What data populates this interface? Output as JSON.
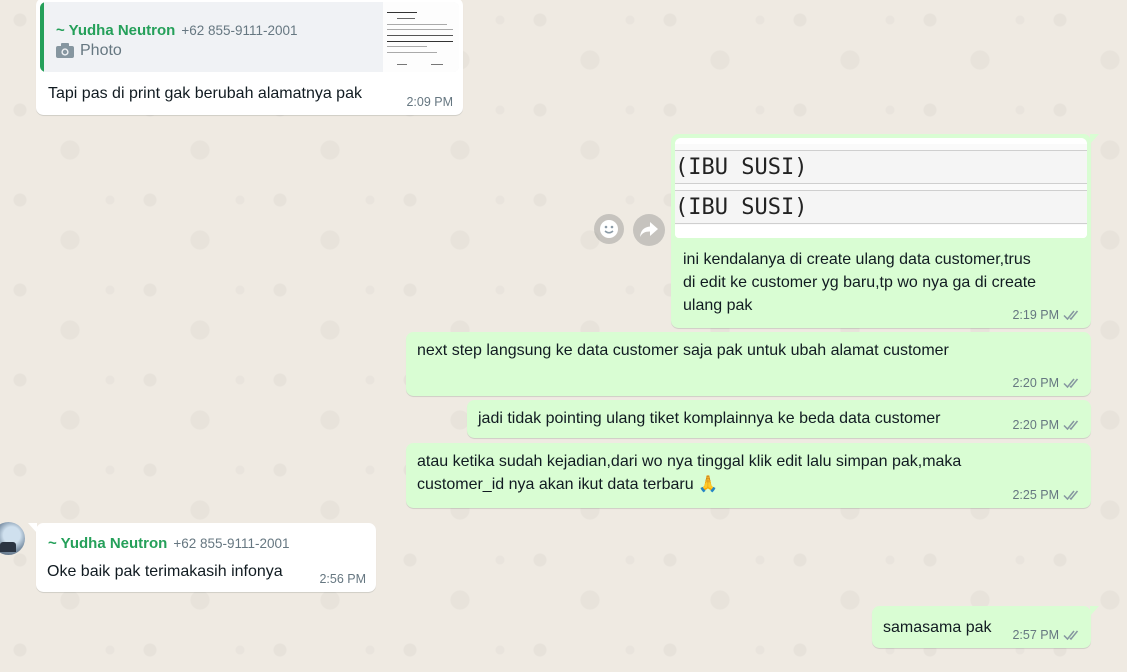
{
  "messages": [
    {
      "direction": "in",
      "reply_to": {
        "sender": "~ Yudha Neutron",
        "phone": "+62 855-9111-2001",
        "media_label": "Photo"
      },
      "text": "Tapi pas di print gak berubah alamatnya pak",
      "time": "2:09 PM"
    },
    {
      "direction": "out",
      "image_lines": [
        "(IBU SUSI)",
        "(IBU SUSI)"
      ],
      "text": "ini kendalanya di create ulang data customer,trus\ndi edit ke customer yg baru,tp wo nya ga di create\nulang pak",
      "time": "2:19 PM"
    },
    {
      "direction": "out",
      "text": "next step langsung ke data customer saja pak untuk ubah alamat customer",
      "time": "2:20 PM"
    },
    {
      "direction": "out",
      "text": "jadi tidak pointing ulang tiket komplainnya ke beda data customer",
      "time": "2:20 PM"
    },
    {
      "direction": "out",
      "text": "atau ketika sudah kejadian,dari wo nya tinggal klik edit lalu simpan pak,maka\ncustomer_id nya akan ikut data terbaru 🙏",
      "time": "2:25 PM"
    },
    {
      "direction": "in",
      "sender": "~ Yudha Neutron",
      "phone": "+62 855-9111-2001",
      "text": "Oke baik pak terimakasih infonya",
      "time": "2:56 PM"
    },
    {
      "direction": "out",
      "text": "samasama pak",
      "time": "2:57 PM"
    }
  ],
  "actions": {
    "react_icon": "emoji-icon",
    "forward_icon": "forward-icon"
  },
  "colors": {
    "background": "#efeae2",
    "outgoing": "#d9fdd3",
    "incoming": "#ffffff",
    "sender": "#25a05a",
    "read_ticks": "#8696a0"
  }
}
